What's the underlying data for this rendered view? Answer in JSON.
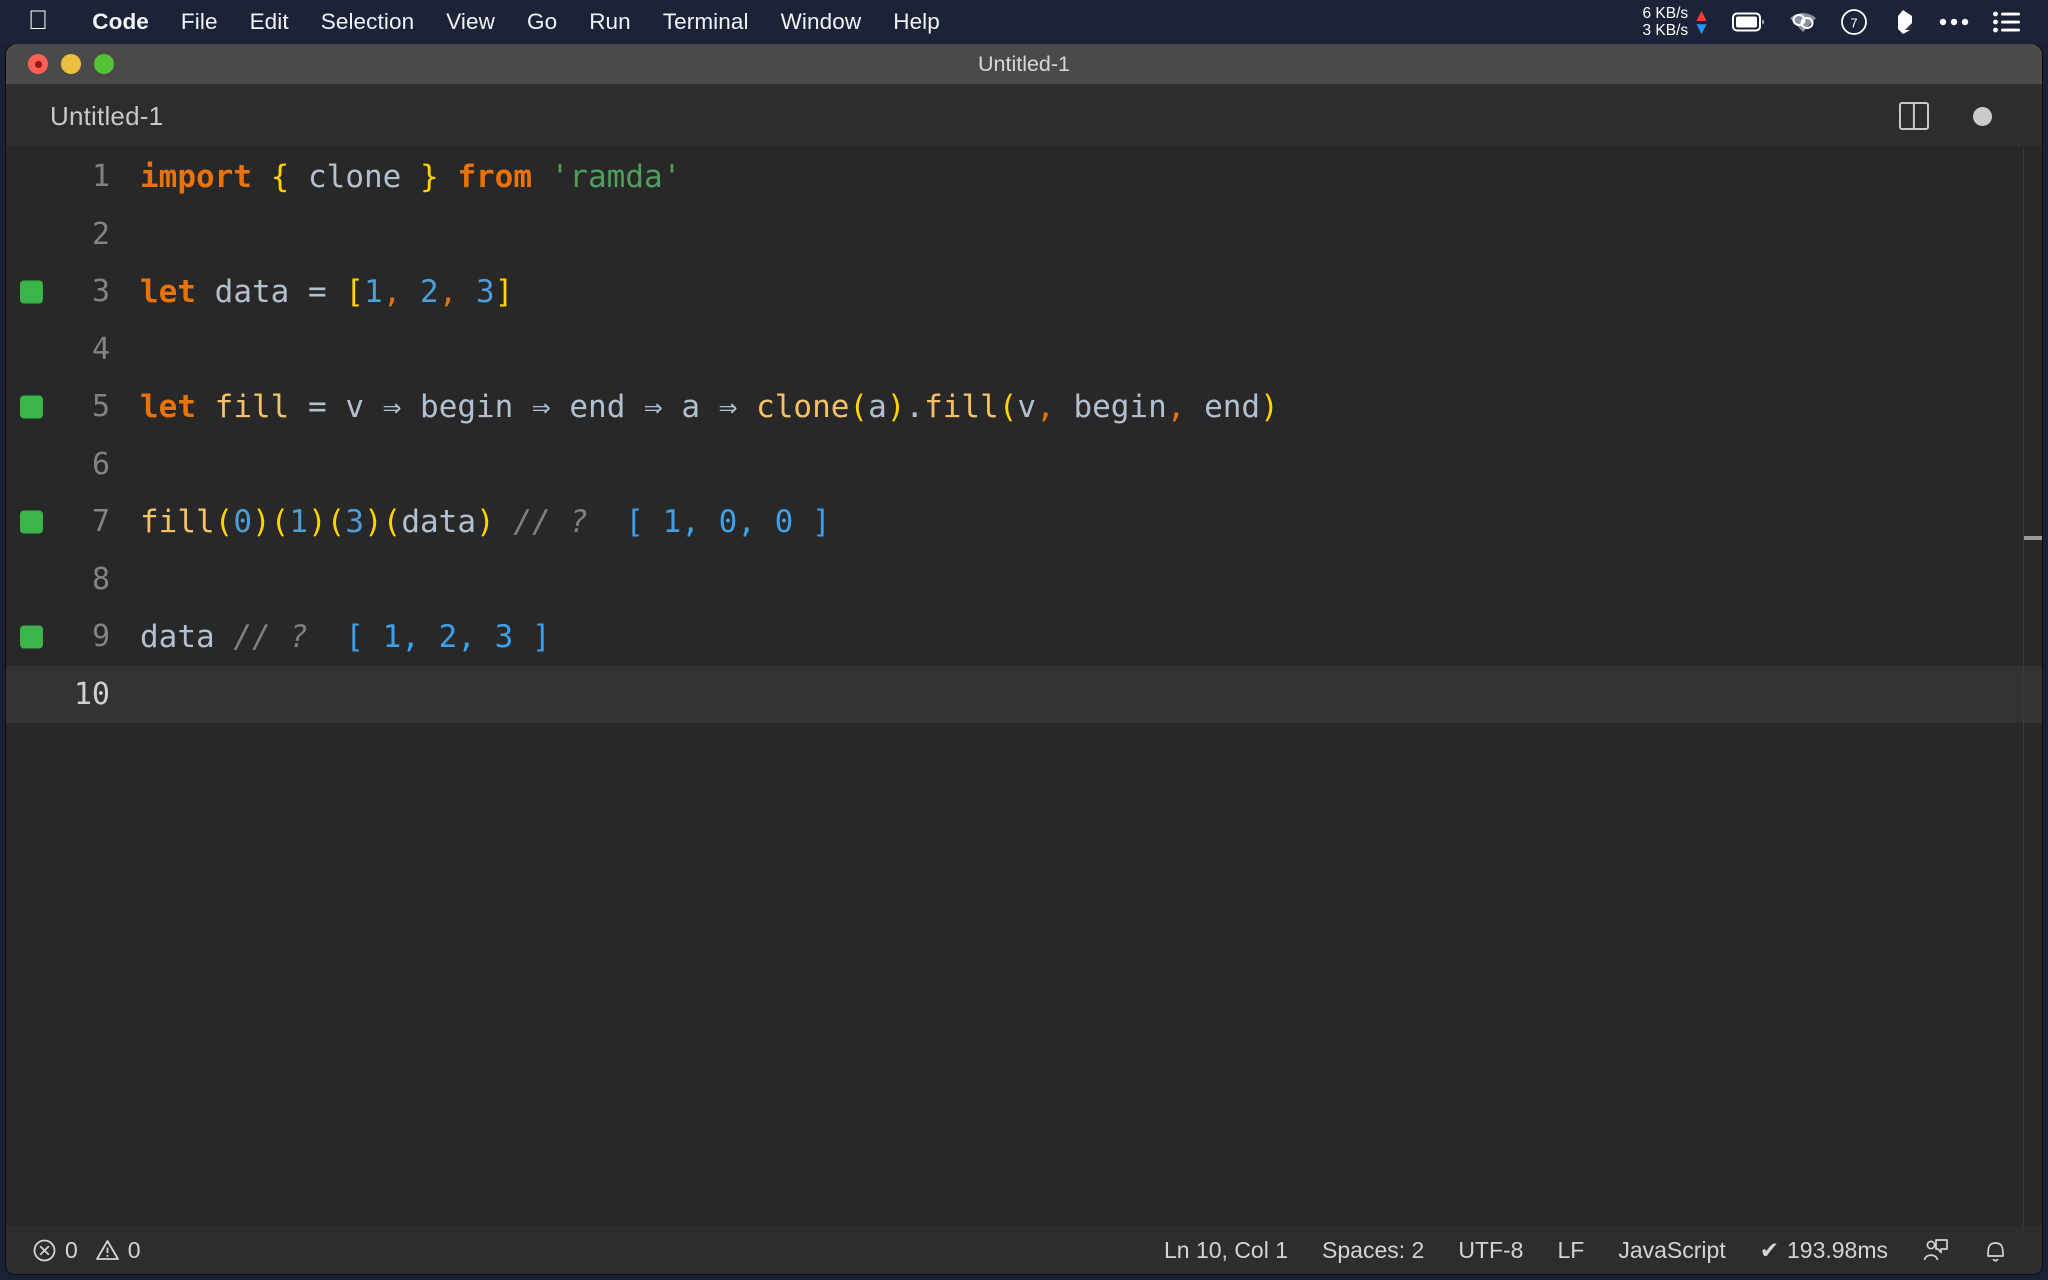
{
  "menubar": {
    "apple_glyph": "",
    "items": [
      {
        "label": "Code",
        "bold": true
      },
      {
        "label": "File"
      },
      {
        "label": "Edit"
      },
      {
        "label": "Selection"
      },
      {
        "label": "View"
      },
      {
        "label": "Go"
      },
      {
        "label": "Run"
      },
      {
        "label": "Terminal"
      },
      {
        "label": "Window"
      },
      {
        "label": "Help"
      }
    ],
    "status": {
      "net_up": "6 KB/s",
      "net_down": "3 KB/s",
      "icons": [
        "battery-icon",
        "wifi-icon",
        "timer-icon",
        "dropbox-icon",
        "ellipsis-icon",
        "control-center-icon"
      ]
    }
  },
  "window": {
    "title": "Untitled-1",
    "traffic_lights": [
      "close-button",
      "minimize-button",
      "maximize-button"
    ]
  },
  "tabbar": {
    "tab_label": "Untitled-1",
    "actions": [
      "split-editor-icon",
      "unsaved-indicator"
    ]
  },
  "editor": {
    "language": "JavaScript",
    "colors": {
      "background": "#282828",
      "keyword": "#e8720c",
      "function": "#f5c168",
      "variable": "#b3c0cf",
      "brace": "#ffd300",
      "number": "#4c9ed9",
      "string": "#4f9e5e",
      "comment": "#7f7f7f",
      "inline_result": "#3fa0ea",
      "coverage_marker": "#3ab54a"
    },
    "lines": [
      {
        "no": "1",
        "covered": false,
        "current": false,
        "text": "import { clone } from 'ramda'"
      },
      {
        "no": "2",
        "covered": false,
        "current": false,
        "text": ""
      },
      {
        "no": "3",
        "covered": true,
        "current": false,
        "text": "let data = [1, 2, 3]"
      },
      {
        "no": "4",
        "covered": false,
        "current": false,
        "text": ""
      },
      {
        "no": "5",
        "covered": true,
        "current": false,
        "text": "let fill = v => begin => end => a => clone(a).fill(v, begin, end)"
      },
      {
        "no": "6",
        "covered": false,
        "current": false,
        "text": ""
      },
      {
        "no": "7",
        "covered": true,
        "current": false,
        "text": "fill(0)(1)(3)(data) // ?  [ 1, 0, 0 ]"
      },
      {
        "no": "8",
        "covered": false,
        "current": false,
        "text": ""
      },
      {
        "no": "9",
        "covered": true,
        "current": false,
        "text": "data // ?  [ 1, 2, 3 ]"
      },
      {
        "no": "10",
        "covered": false,
        "current": true,
        "text": ""
      }
    ],
    "inline_results": [
      {
        "line": "7",
        "value": "[ 1, 0, 0 ]"
      },
      {
        "line": "9",
        "value": "[ 1, 2, 3 ]"
      }
    ]
  },
  "statusbar": {
    "errors": "0",
    "warnings": "0",
    "cursor": "Ln 10, Col 1",
    "indent": "Spaces: 2",
    "encoding": "UTF-8",
    "eol": "LF",
    "language": "JavaScript",
    "quokka_check": "✔",
    "quokka_time": "193.98ms",
    "right_icons": [
      "feedback-icon",
      "bell-icon"
    ]
  }
}
